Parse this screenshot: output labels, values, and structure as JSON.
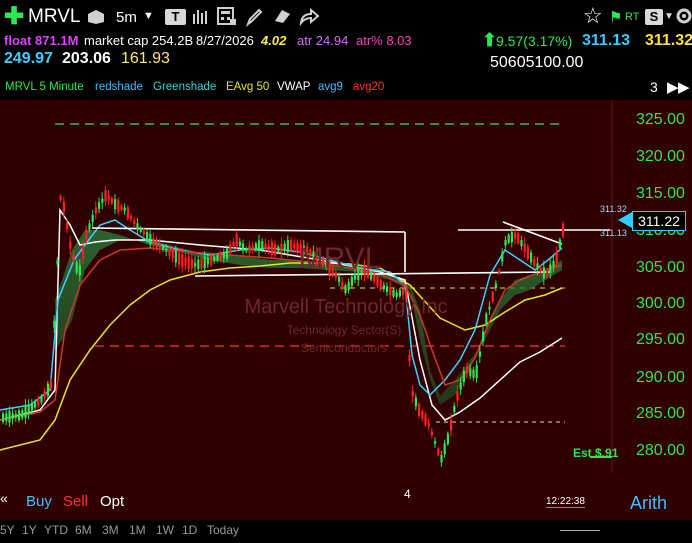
{
  "header": {
    "symbol": "MRVL",
    "interval": "5m",
    "rt_label": "RT",
    "sv_label": "S",
    "float_text": "float 871.1M",
    "market_cap_text": "market cap 254.2B",
    "date_text": "8/27/2026",
    "beta_text": "4.02",
    "atr_text": "atr 24.94",
    "atr_pct_text": "atr% 8.03",
    "change_text": "9.57(3.17%)",
    "last_price": "311.13",
    "ask_price": "311.32",
    "high_52": "249.97",
    "mid_price": "203.06",
    "low_52": "161.93",
    "volume_text": "50605100.00"
  },
  "legend": {
    "items": [
      {
        "label": "MRVL 5 Minute",
        "color": "#2ee64f"
      },
      {
        "label": "redshade",
        "color": "#3fbfff"
      },
      {
        "label": "Greenshade",
        "color": "#3fd1d1"
      },
      {
        "label": "EAvg 50",
        "color": "#e6e61e"
      },
      {
        "label": "VWAP",
        "color": "#ffffff"
      },
      {
        "label": "avg9",
        "color": "#3fbfff"
      },
      {
        "label": "avg20",
        "color": "#ff3030"
      }
    ],
    "page_count": "3"
  },
  "chart": {
    "watermark_symbol": "MRVL",
    "watermark_name": "Marvell Technology Inc",
    "watermark_sector": "Technology Sector(S)",
    "watermark_industry": "Semiconductors",
    "y_axis": [
      "325.00",
      "320.00",
      "315.00",
      "310.00",
      "305.00",
      "300.00",
      "295.00",
      "290.00",
      "285.00",
      "280.00"
    ],
    "price_tag": "311.22",
    "small_tag_upper": "311.32",
    "small_tag_lower": "311.13",
    "est_label": "Est $.91",
    "x_label": "4",
    "clock": "12:22:38",
    "scale_mode": "Arith"
  },
  "trade": {
    "buy_label": "Buy",
    "sell_label": "Sell",
    "opt_label": "Opt"
  },
  "timeframes": [
    "5Y",
    "1Y",
    "YTD",
    "6M",
    "3M",
    "1M",
    "1W",
    "1D",
    "Today"
  ],
  "colors": {
    "up": "#2ee64f",
    "down": "#ff2020",
    "chart_bg": "#300000",
    "accent_cyan": "#33ccff"
  }
}
